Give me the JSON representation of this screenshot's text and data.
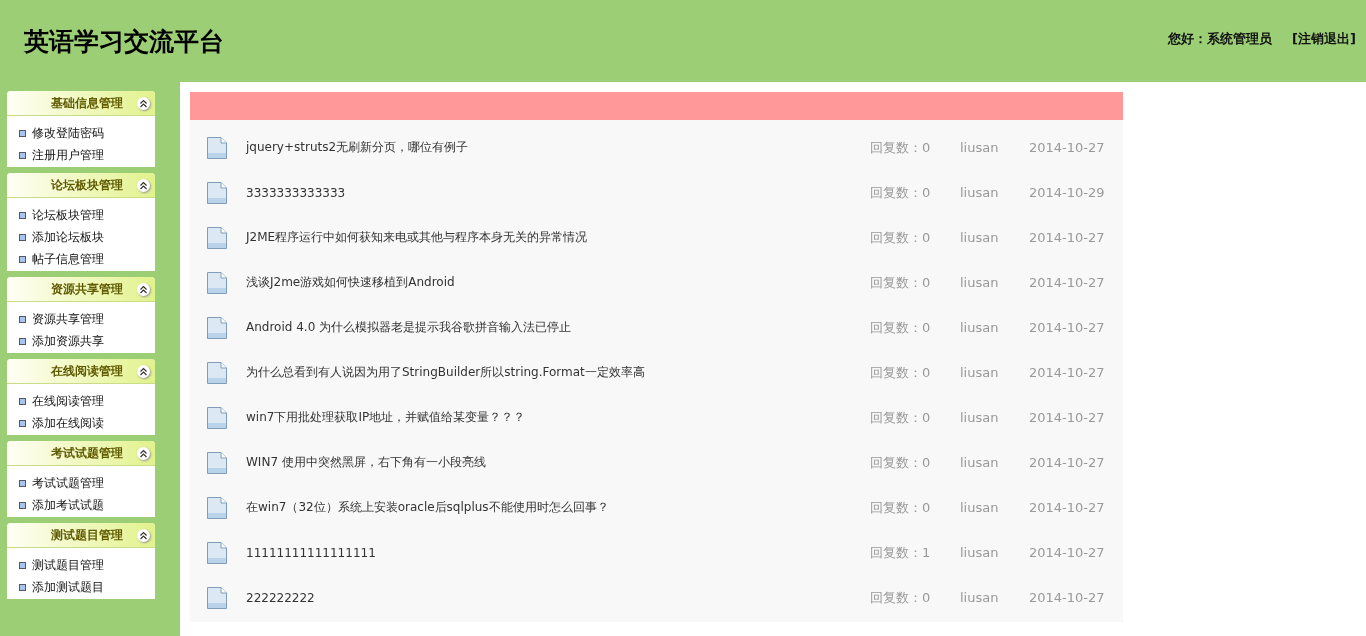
{
  "header": {
    "title": "英语学习交流平台",
    "greeting": "您好：系统管理员",
    "logout": "[注销退出]"
  },
  "sidebar": [
    {
      "title": "基础信息管理",
      "expanded": true,
      "items": [
        "修改登陆密码",
        "注册用户管理"
      ]
    },
    {
      "title": "论坛板块管理",
      "expanded": true,
      "items": [
        "论坛板块管理",
        "添加论坛板块",
        "帖子信息管理"
      ]
    },
    {
      "title": "资源共享管理",
      "expanded": true,
      "items": [
        "资源共享管理",
        "添加资源共享"
      ]
    },
    {
      "title": "在线阅读管理",
      "expanded": true,
      "items": [
        "在线阅读管理",
        "添加在线阅读"
      ]
    },
    {
      "title": "考试试题管理",
      "expanded": true,
      "items": [
        "考试试题管理",
        "添加考试试题"
      ]
    },
    {
      "title": "测试题目管理",
      "expanded": true,
      "items": [
        "测试题目管理",
        "添加测试题目"
      ]
    }
  ],
  "posts": [
    {
      "title": "jquery+struts2无刷新分页，哪位有例子",
      "replies": "回复数：0",
      "author": "liusan",
      "date": "2014-10-27"
    },
    {
      "title": "3333333333333",
      "replies": "回复数：0",
      "author": "liusan",
      "date": "2014-10-29"
    },
    {
      "title": "J2ME程序运行中如何获知来电或其他与程序本身无关的异常情况",
      "replies": "回复数：0",
      "author": "liusan",
      "date": "2014-10-27"
    },
    {
      "title": "浅谈J2me游戏如何快速移植到Android",
      "replies": "回复数：0",
      "author": "liusan",
      "date": "2014-10-27"
    },
    {
      "title": "Android 4.0 为什么模拟器老是提示我谷歌拼音输入法已停止",
      "replies": "回复数：0",
      "author": "liusan",
      "date": "2014-10-27"
    },
    {
      "title": "为什么总看到有人说因为用了StringBuilder所以string.Format一定效率高",
      "replies": "回复数：0",
      "author": "liusan",
      "date": "2014-10-27"
    },
    {
      "title": "win7下用批处理获取IP地址，并赋值给某变量？？？",
      "replies": "回复数：0",
      "author": "liusan",
      "date": "2014-10-27"
    },
    {
      "title": "WIN7 使用中突然黑屏，右下角有一小段亮线",
      "replies": "回复数：0",
      "author": "liusan",
      "date": "2014-10-27"
    },
    {
      "title": "在win7（32位）系统上安装oracle后sqlplus不能使用时怎么回事？",
      "replies": "回复数：0",
      "author": "liusan",
      "date": "2014-10-27"
    },
    {
      "title": "11111111111111111",
      "replies": "回复数：1",
      "author": "liusan",
      "date": "2014-10-27"
    },
    {
      "title": "222222222",
      "replies": "回复数：0",
      "author": "liusan",
      "date": "2014-10-27"
    }
  ]
}
